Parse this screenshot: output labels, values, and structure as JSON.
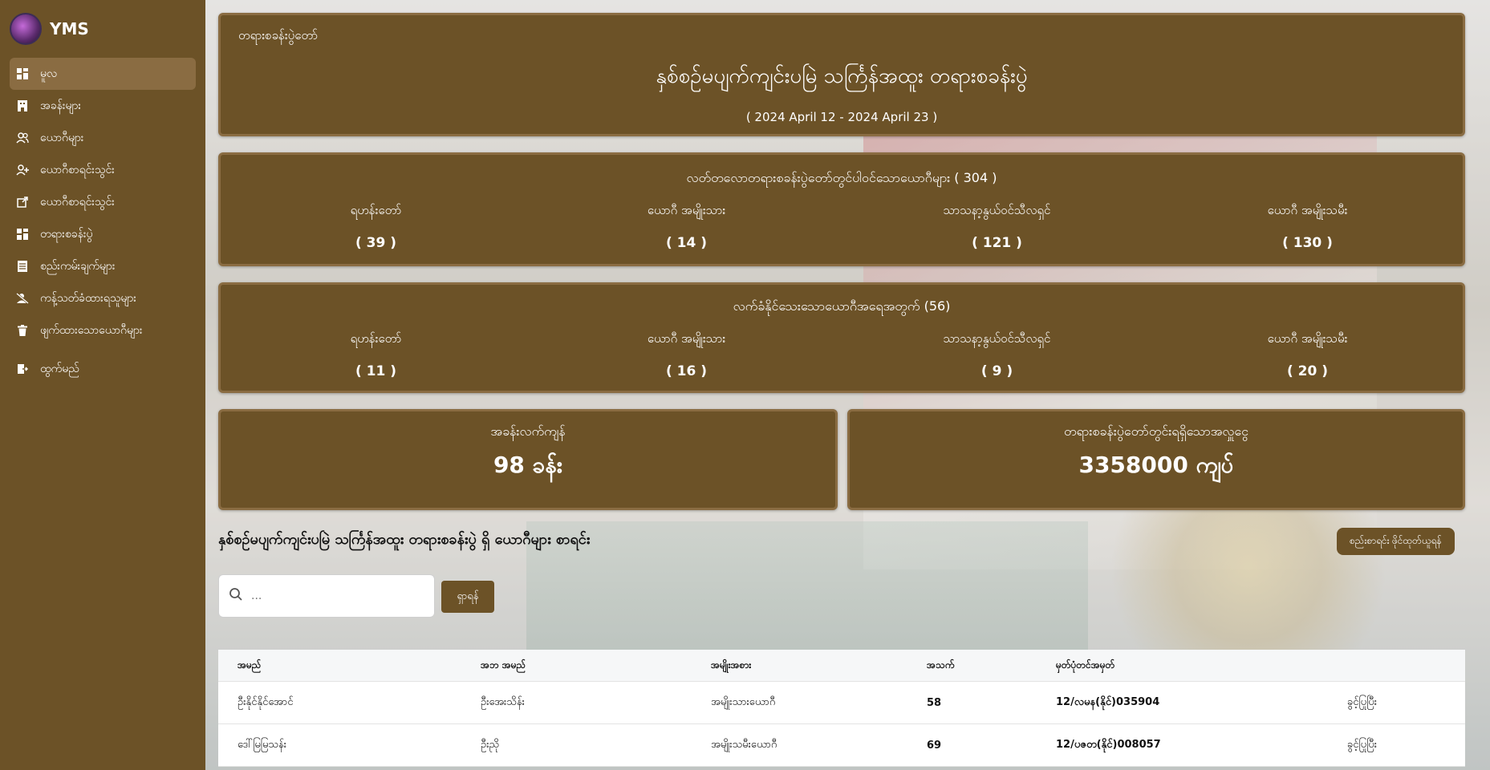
{
  "brand": {
    "name": "YMS"
  },
  "sidebar": {
    "items": [
      {
        "label": "မူလ",
        "icon": "dashboard-icon",
        "active": true
      },
      {
        "label": "အခန်းများ",
        "icon": "room-icon"
      },
      {
        "label": "ယောဂီများ",
        "icon": "users-icon"
      },
      {
        "label": "ယောဂီစာရင်းသွင်း",
        "icon": "add-user-icon"
      },
      {
        "label": "ယောဂီစာရင်းသွင်း",
        "icon": "external-link-icon"
      },
      {
        "label": "တရားစခန်းပွဲ",
        "icon": "dashboard-icon"
      },
      {
        "label": "စည်းကမ်းချက်များ",
        "icon": "list-icon"
      },
      {
        "label": "ကန့်သတ်ခံထားရသူများ",
        "icon": "block-user-icon"
      },
      {
        "label": "ဖျက်ထားသောယောဂီများ",
        "icon": "trash-icon"
      }
    ],
    "logout": {
      "label": "ထွက်မည်",
      "icon": "logout-icon"
    }
  },
  "event": {
    "caption": "တရားစခန်းပွဲတော်",
    "title": "နှစ်စဉ်မပျက်ကျင်းပမြဲ သင်္ကြန်အထူး တရားစခန်းပွဲ",
    "date_range": "( 2024 April 12 - 2024 April 23 )"
  },
  "registered": {
    "heading": "လတ်တလောတရားစခန်းပွဲတော်တွင်ပါဝင်သောယောဂီများ ( 304 )",
    "stats": [
      {
        "label": "ရဟန်းတော်",
        "value": "( 39 )"
      },
      {
        "label": "ယောဂီ အမျိုးသား",
        "value": "( 14 )"
      },
      {
        "label": "သာသနာ့နွယ်ဝင်သီလရှင်",
        "value": "( 121 )"
      },
      {
        "label": "ယောဂီ အမျိုးသမီး",
        "value": "( 130 )"
      }
    ]
  },
  "available": {
    "heading": "လက်ခံနိုင်သေးသောယောဂီအရေအတွက် (56)",
    "stats": [
      {
        "label": "ရဟန်းတော်",
        "value": "( 11 )"
      },
      {
        "label": "ယောဂီ အမျိုးသား",
        "value": "( 16 )"
      },
      {
        "label": "သာသနာ့နွယ်ဝင်သီလရှင်",
        "value": "( 9 )"
      },
      {
        "label": "ယောဂီ အမျိုးသမီး",
        "value": "( 20 )"
      }
    ]
  },
  "summary": {
    "rooms_label": "အခန်းလက်ကျန်",
    "rooms_value": "98 ခန်း",
    "donation_label": "တရားစခန်းပွဲတော်တွင်းရရှိသောအလှူငွေ",
    "donation_value": "3358000 ကျပ်"
  },
  "list": {
    "title": "နှစ်စဉ်မပျက်ကျင်းပမြဲ သင်္ကြန်အထူး တရားစခန်းပွဲ ရှိ ယောဂီများ စာရင်း",
    "export_label": "စည်းစာရင်း ဖိုင်ထုတ်ယူရန်",
    "search_placeholder": "...",
    "search_button": "ရှာရန်",
    "columns": [
      "အမည်",
      "အဘ အမည်",
      "အမျိုးအစား",
      "အသက်",
      "မှတ်ပုံတင်အမှတ်",
      ""
    ],
    "rows": [
      {
        "name": "ဦးနိုင်နိုင်အောင်",
        "father": "ဦးအေးသိန်း",
        "type": "အမျိုးသားယောဂီ",
        "age": "58",
        "nrc": "12/လမန(နိုင်)035904",
        "status": "ခွင့်ပြုပြီး"
      },
      {
        "name": "ဒေါ်မြမြသန်း",
        "father": "ဦးညို",
        "type": "အမျိုးသမီးယောဂီ",
        "age": "69",
        "nrc": "12/ပဇတ(နိုင်)008057",
        "status": "ခွင့်ပြုပြီး"
      }
    ]
  }
}
